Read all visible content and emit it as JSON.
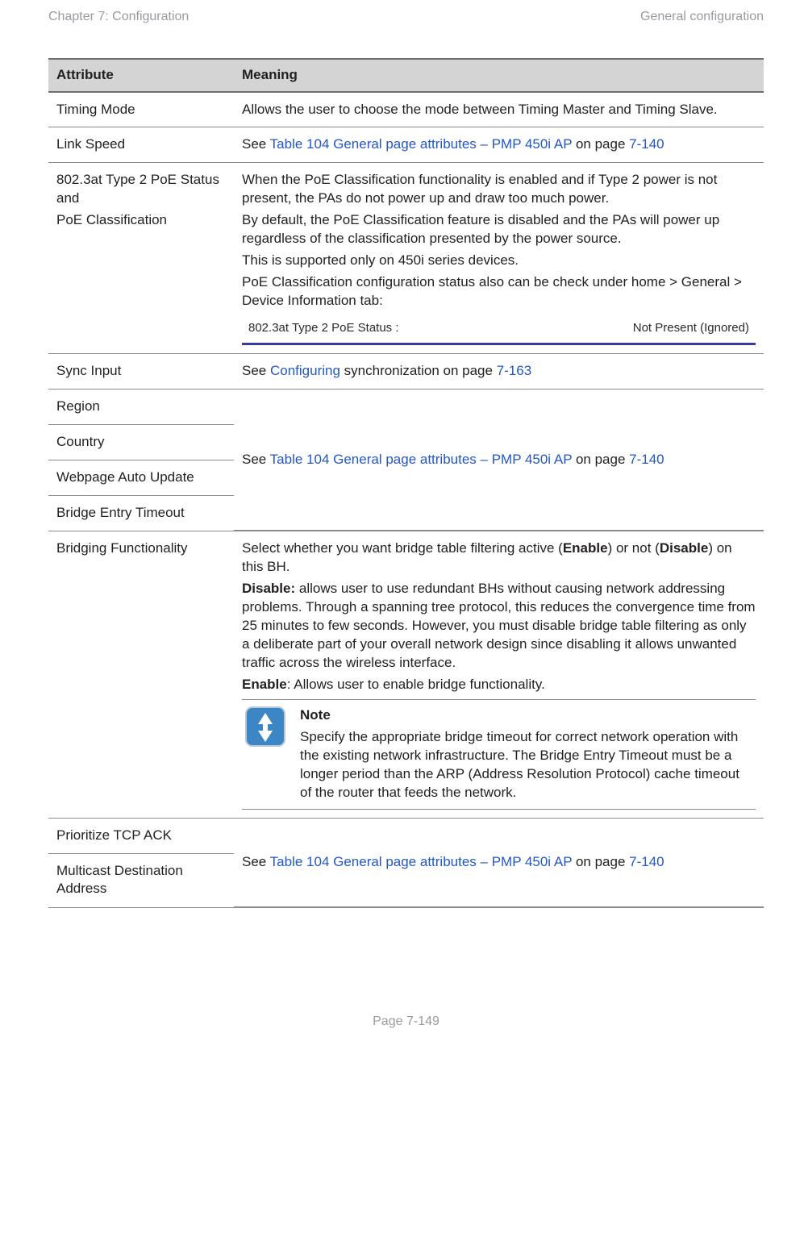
{
  "header": {
    "left": "Chapter 7:  Configuration",
    "right": "General configuration"
  },
  "tableHeaders": {
    "attr": "Attribute",
    "meaning": "Meaning"
  },
  "rows": {
    "timingMode": {
      "attr": "Timing Mode",
      "meaning": "Allows the user to choose the mode between Timing Master and Timing Slave."
    },
    "linkSpeed": {
      "attr": "Link Speed",
      "prefix": "See ",
      "link": "Table 104 General page attributes – PMP 450i AP",
      "mid": " on page ",
      "page": "7-140"
    },
    "poe": {
      "attr1": "802.3at Type 2 PoE Status and",
      "attr2": "PoE Classification",
      "p1": "When the PoE Classification functionality is enabled and if Type 2 power is not present, the PAs do not power up and draw too much power.",
      "p2": "By default, the PoE Classification feature is disabled and the PAs will power up regardless of the classification presented by the power source.",
      "p3": "This is supported only on 450i series devices.",
      "p4": "PoE Classification configuration status also can be check under home > General > Device Information tab:",
      "stripLabel": "802.3at Type 2 PoE Status :",
      "stripValue": "Not Present (Ignored)"
    },
    "syncInput": {
      "attr": "Sync Input",
      "prefix": "See ",
      "link": "Configuring",
      "mid1": " synchronization on page ",
      "page": "7-163"
    },
    "block1": {
      "region": "Region",
      "country": "Country",
      "webpage": "Webpage Auto Update",
      "bridgeTimeout": "Bridge Entry Timeout",
      "prefix": "See ",
      "link": "Table 104 General page attributes – PMP 450i AP",
      "mid": " on page ",
      "page": "7-140"
    },
    "bridging": {
      "attr": "Bridging Functionality",
      "p1a": "Select whether you want bridge table filtering active (",
      "p1b": "Enable",
      "p1c": ") or not (",
      "p1d": "Disable",
      "p1e": ") on this BH.",
      "disableLabel": "Disable:",
      "disableText": " allows user to use redundant BHs without causing network addressing problems. Through a spanning tree protocol, this reduces the convergence time from 25 minutes to few seconds. However, you must disable bridge table filtering as only a deliberate part of your overall network design since disabling it allows unwanted traffic across the wireless interface.",
      "enableLabel": "Enable",
      "enableText": ": Allows user to enable bridge functionality.",
      "noteTitle": "Note",
      "noteBody": "Specify the appropriate bridge timeout for correct network operation with the existing network infrastructure. The Bridge Entry Timeout must be a longer period than the ARP (Address Resolution Protocol) cache timeout of the router that feeds the network."
    },
    "block2": {
      "prioritize": "Prioritize TCP ACK",
      "multicast": "Multicast Destination Address",
      "prefix": "See ",
      "link": "Table 104 General page attributes – PMP 450i AP",
      "mid": " on page ",
      "page": "7-140"
    }
  },
  "footer": {
    "page": "Page 7-149"
  }
}
